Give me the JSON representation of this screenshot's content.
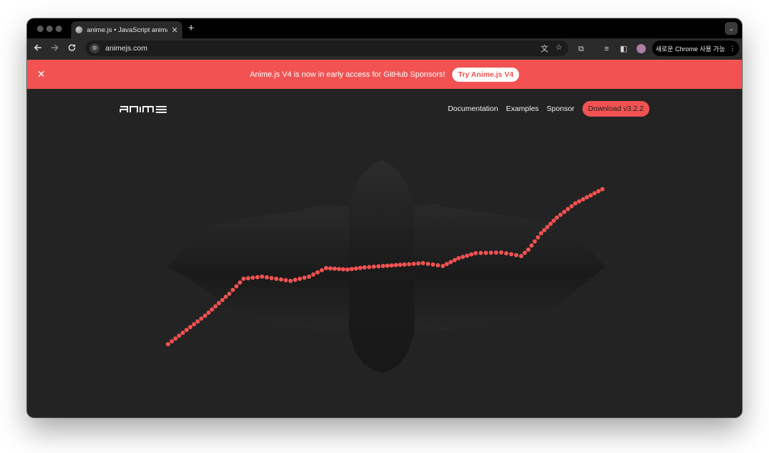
{
  "browser": {
    "tab_title": "anime.js • JavaScript animati",
    "new_tab_symbol": "+",
    "url": "animejs.com",
    "chrome_pill_label": "새로운 Chrome 사용 가능"
  },
  "banner": {
    "message": "Anime.js V4 is now in early access for GitHub Sponsors!",
    "button_label": "Try Anime.js V4",
    "background": "#f25252"
  },
  "site": {
    "logo_text": "anime",
    "nav": [
      {
        "label": "Documentation"
      },
      {
        "label": "Examples"
      },
      {
        "label": "Sponsor"
      }
    ],
    "download_label": "Download v3.2.2",
    "accent": "#f25252"
  },
  "icons": {
    "back": "arrow-left-icon",
    "forward": "arrow-right-icon",
    "reload": "reload-icon",
    "site_info": "tune-icon",
    "translate": "translate-icon",
    "bookmark": "star-icon",
    "extensions": "puzzle-icon",
    "media": "media-queue-icon",
    "sidepanel": "side-panel-icon",
    "menu": "kebab-menu-icon",
    "close": "close-icon"
  }
}
